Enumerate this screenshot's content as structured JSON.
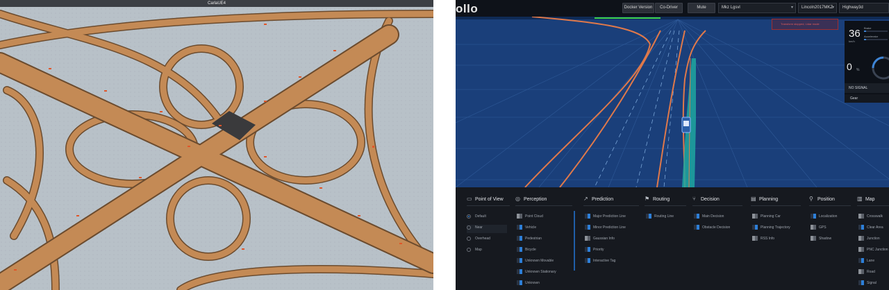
{
  "carla": {
    "window_title": "CarlaUE4"
  },
  "apollo": {
    "logo": "ollo",
    "topbar": {
      "docker_version": "Docker Version",
      "co_driver": "Co-Driver",
      "mute": "Mute",
      "mode_value": "Mkz Lgsvl",
      "vehicle_value": "Lincoln2017MKZ",
      "map_value": "Highway3d"
    },
    "warning_text": "Transform stopped, Lidar mode",
    "status": {
      "speed": "36",
      "speed_unit": "km/h",
      "brake_label": "Brake",
      "accelerator_label": "Accelerator",
      "steering": "0",
      "steering_unit": "%",
      "signal": "NO SIGNAL",
      "gear": "Gear"
    },
    "sections": [
      {
        "icon": "camera-icon",
        "title": "Point of View"
      },
      {
        "icon": "eye-icon",
        "title": "Perception"
      },
      {
        "icon": "chart-icon",
        "title": "Prediction"
      },
      {
        "icon": "flag-icon",
        "title": "Routing"
      },
      {
        "icon": "split-icon",
        "title": "Decision"
      },
      {
        "icon": "doc-icon",
        "title": "Planning"
      },
      {
        "icon": "pin-icon",
        "title": "Position"
      },
      {
        "icon": "map-icon",
        "title": "Map"
      }
    ],
    "point_of_view": [
      {
        "label": "Default",
        "selected": true
      },
      {
        "label": "Near",
        "selected": false
      },
      {
        "label": "Overhead",
        "selected": false
      },
      {
        "label": "Map",
        "selected": false
      }
    ],
    "perception": [
      {
        "label": "Point Cloud",
        "on": false
      },
      {
        "label": "Vehicle",
        "on": true
      },
      {
        "label": "Pedestrian",
        "on": true
      },
      {
        "label": "Bicycle",
        "on": true
      },
      {
        "label": "Unknown Movable",
        "on": true
      },
      {
        "label": "Unknown Stationary",
        "on": true
      },
      {
        "label": "Unknown",
        "on": true
      }
    ],
    "prediction": [
      {
        "label": "Major Prediction Line",
        "on": true
      },
      {
        "label": "Minor Prediction Line",
        "on": true
      },
      {
        "label": "Gaussian Info",
        "on": false
      },
      {
        "label": "Priority",
        "on": true
      },
      {
        "label": "Interactive Tag",
        "on": true
      }
    ],
    "routing": [
      {
        "label": "Routing Line",
        "on": true
      }
    ],
    "decision": [
      {
        "label": "Main Decision",
        "on": true
      },
      {
        "label": "Obstacle Decision",
        "on": true
      }
    ],
    "planning": [
      {
        "label": "Planning Car",
        "on": false
      },
      {
        "label": "Planning Trajectory",
        "on": true
      },
      {
        "label": "RSS Info",
        "on": false
      }
    ],
    "position": [
      {
        "label": "Localization",
        "on": true
      },
      {
        "label": "GPS",
        "on": false
      },
      {
        "label": "Shadow",
        "on": false
      }
    ],
    "map": [
      {
        "label": "Crosswalk",
        "on": false
      },
      {
        "label": "Clear Area",
        "on": true
      },
      {
        "label": "Junction",
        "on": false
      },
      {
        "label": "PNC Junction",
        "on": false
      },
      {
        "label": "Lane",
        "on": true
      },
      {
        "label": "Road",
        "on": false
      },
      {
        "label": "Signal",
        "on": true
      }
    ],
    "colors": {
      "accent": "#2d7fd8",
      "road_orange": "#e0794a",
      "trajectory_teal": "#1fa7a0",
      "ground": "#1a3f7a"
    }
  }
}
